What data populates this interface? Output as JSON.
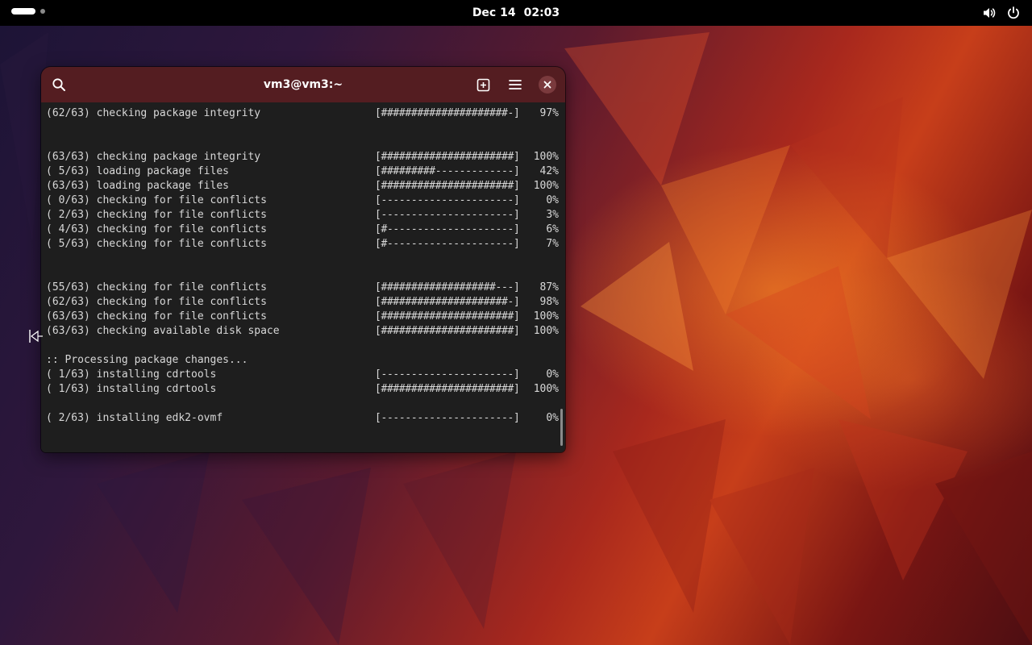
{
  "topbar": {
    "date": "Dec 14",
    "time": "02:03",
    "icons": [
      "workspace-indicator",
      "volume-icon",
      "power-icon"
    ]
  },
  "window": {
    "title": "vm3@vm3:~",
    "icons": [
      "search-icon",
      "new-tab-icon",
      "menu-icon",
      "close-icon"
    ]
  },
  "terminal": {
    "lines": [
      {
        "msg": "(62/63) checking package integrity",
        "bar": "[#####################-]",
        "pct": "97%"
      },
      {
        "msg": "",
        "bar": "",
        "pct": ""
      },
      {
        "msg": "",
        "bar": "",
        "pct": ""
      },
      {
        "msg": "(63/63) checking package integrity",
        "bar": "[######################]",
        "pct": "100%"
      },
      {
        "msg": "( 5/63) loading package files",
        "bar": "[#########-------------]",
        "pct": "42%"
      },
      {
        "msg": "(63/63) loading package files",
        "bar": "[######################]",
        "pct": "100%"
      },
      {
        "msg": "( 0/63) checking for file conflicts",
        "bar": "[----------------------]",
        "pct": "0%"
      },
      {
        "msg": "( 2/63) checking for file conflicts",
        "bar": "[----------------------]",
        "pct": "3%"
      },
      {
        "msg": "( 4/63) checking for file conflicts",
        "bar": "[#---------------------]",
        "pct": "6%"
      },
      {
        "msg": "( 5/63) checking for file conflicts",
        "bar": "[#---------------------]",
        "pct": "7%"
      },
      {
        "msg": "",
        "bar": "",
        "pct": ""
      },
      {
        "msg": "",
        "bar": "",
        "pct": ""
      },
      {
        "msg": "(55/63) checking for file conflicts",
        "bar": "[###################---]",
        "pct": "87%"
      },
      {
        "msg": "(62/63) checking for file conflicts",
        "bar": "[#####################-]",
        "pct": "98%"
      },
      {
        "msg": "(63/63) checking for file conflicts",
        "bar": "[######################]",
        "pct": "100%"
      },
      {
        "msg": "(63/63) checking available disk space",
        "bar": "[######################]",
        "pct": "100%"
      },
      {
        "msg": "",
        "bar": "",
        "pct": ""
      },
      {
        "msg": ":: Processing package changes...",
        "bar": "",
        "pct": ""
      },
      {
        "msg": "( 1/63) installing cdrtools",
        "bar": "[----------------------]",
        "pct": "0%"
      },
      {
        "msg": "( 1/63) installing cdrtools",
        "bar": "[######################]",
        "pct": "100%"
      },
      {
        "msg": "",
        "bar": "",
        "pct": ""
      },
      {
        "msg": "( 2/63) installing edk2-ovmf",
        "bar": "[----------------------]",
        "pct": "0%"
      }
    ]
  },
  "colors": {
    "headerbar": "#541d21",
    "terminal_bg": "#1e1e1e",
    "terminal_fg": "#d8d8d8",
    "topbar": "#000000"
  }
}
